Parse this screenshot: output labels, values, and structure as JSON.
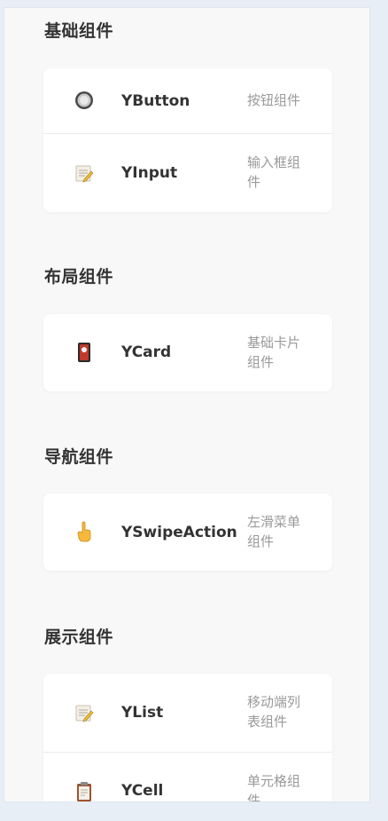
{
  "sections": [
    {
      "title": "基础组件",
      "items": [
        {
          "icon": "radio-button-icon",
          "name": "YButton",
          "desc": "按钮组件"
        },
        {
          "icon": "memo-icon",
          "name": "YInput",
          "desc": "输入框组件"
        }
      ]
    },
    {
      "title": "布局组件",
      "items": [
        {
          "icon": "card-icon",
          "name": "YCard",
          "desc": "基础卡片组件"
        }
      ]
    },
    {
      "title": "导航组件",
      "items": [
        {
          "icon": "pointing-hand-icon",
          "name": "YSwipeAction",
          "desc": "左滑菜单组件"
        }
      ]
    },
    {
      "title": "展示组件",
      "items": [
        {
          "icon": "memo-icon",
          "name": "YList",
          "desc": "移动端列表组件"
        },
        {
          "icon": "clipboard-icon",
          "name": "YCell",
          "desc": "单元格组件"
        }
      ]
    }
  ]
}
